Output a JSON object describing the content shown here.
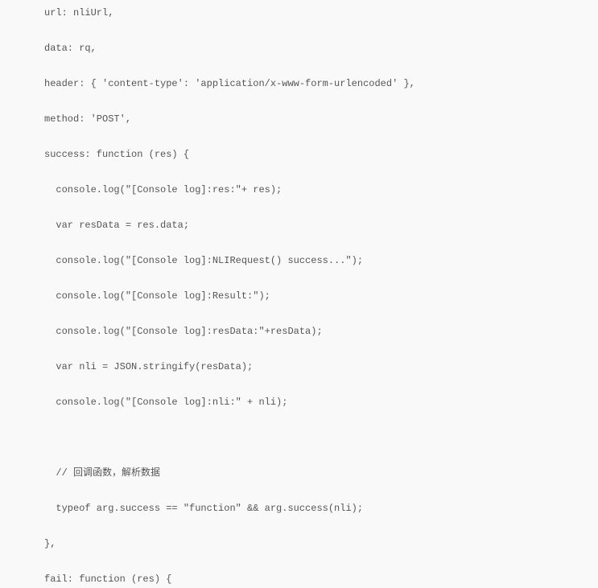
{
  "code": {
    "lines": [
      "url: nliUrl,",
      "",
      "data: rq,",
      "",
      "header: { 'content-type': 'application/x-www-form-urlencoded' },",
      "",
      "method: 'POST',",
      "",
      "success: function (res) {",
      "",
      "  console.log(\"[Console log]:res:\"+ res);",
      "",
      "  var resData = res.data;",
      "",
      "  console.log(\"[Console log]:NLIRequest() success...\");",
      "",
      "  console.log(\"[Console log]:Result:\");",
      "",
      "  console.log(\"[Console log]:resData:\"+resData);",
      "",
      "  var nli = JSON.stringify(resData);",
      "",
      "  console.log(\"[Console log]:nli:\" + nli);",
      "",
      "",
      "",
      "  // 回调函数，解析数据",
      "",
      "  typeof arg.success == \"function\" && arg.success(nli);",
      "",
      "},",
      "",
      "fail: function (res) {"
    ]
  }
}
